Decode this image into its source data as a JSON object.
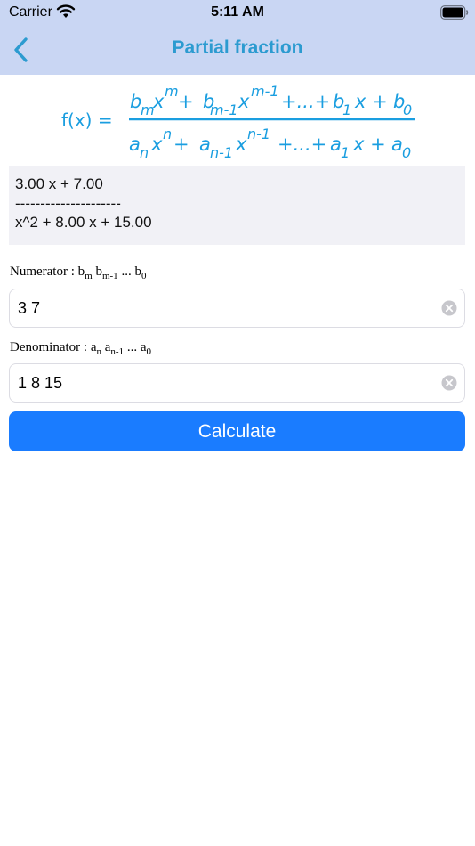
{
  "status_bar": {
    "carrier": "Carrier",
    "time": "5:11 AM"
  },
  "nav": {
    "title": "Partial fraction",
    "back_icon": "chevron-left-icon"
  },
  "formula": {
    "lhs": "f(x) =",
    "num": {
      "b": "b",
      "m": "m",
      "x": "x",
      "exp_m": "m",
      "plus": "+",
      "m_minus_1": "m-1",
      "exp_m_minus_1": "m-1",
      "dots": "+...+",
      "one": "1",
      "x_plus": "x +",
      "zero": "0"
    },
    "den": {
      "a": "a",
      "n": "n",
      "x": "x",
      "exp_n": "n",
      "plus": "+",
      "n_minus_1": "n-1",
      "exp_n_minus_1": "n-1",
      "dots": "+...+",
      "one": "1",
      "x_plus": "x +",
      "zero": "0"
    }
  },
  "preview": {
    "numerator": "3.00 x + 7.00",
    "separator": "---------------------",
    "denominator": "x^2 + 8.00 x + 15.00"
  },
  "numerator_label": {
    "prefix": "Numerator : ",
    "b1": "b",
    "s1": "m",
    "b2": " b",
    "s2": "m-1",
    "dots": " ... b",
    "s3": "0"
  },
  "numerator_input": {
    "value": "3 7"
  },
  "denominator_label": {
    "prefix": "Denominator : ",
    "a1": "a",
    "s1": "n",
    "a2": " a",
    "s2": "n-1",
    "dots": " ... a",
    "s3": "0"
  },
  "denominator_input": {
    "value": "1 8 15"
  },
  "calculate_button": {
    "label": "Calculate"
  },
  "colors": {
    "nav_background": "#c9d6f3",
    "title": "#2c9bd0",
    "formula": "#1a9ee0",
    "button": "#1a7cff",
    "preview_background": "#f1f1f6"
  }
}
